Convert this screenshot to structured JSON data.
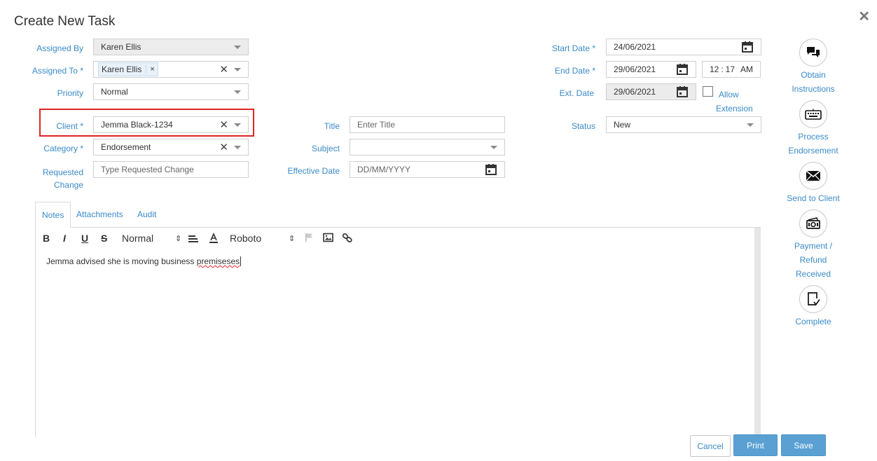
{
  "dialog": {
    "title": "Create New Task"
  },
  "form": {
    "assigned_by": {
      "label": "Assigned By",
      "value": "Karen Ellis"
    },
    "assigned_to": {
      "label": "Assigned To *",
      "tag": "Karen Ellis",
      "tag_remove": "×"
    },
    "priority": {
      "label": "Priority",
      "value": "Normal"
    },
    "client": {
      "label": "Client *",
      "value": "Jemma Black-1234"
    },
    "category": {
      "label": "Category *",
      "value": "Endorsement"
    },
    "requested_change": {
      "label_line1": "Requested",
      "label_line2": "Change",
      "placeholder": "Type Requested Change"
    },
    "title": {
      "label": "Title",
      "placeholder": "Enter Title"
    },
    "subject": {
      "label": "Subject",
      "value": ""
    },
    "effective_date": {
      "label": "Effective Date",
      "placeholder": "DD/MM/YYYY"
    },
    "start_date": {
      "label": "Start Date *",
      "value": "24/06/2021"
    },
    "end_date": {
      "label": "End Date *",
      "value": "29/06/2021",
      "time_hour": "12",
      "time_sep": ":",
      "time_min": "17",
      "time_ampm": "AM"
    },
    "ext_date": {
      "label": "Ext. Date",
      "value": "29/06/2021"
    },
    "allow_extension": {
      "line1": "Allow",
      "line2": "Extension",
      "checked": false
    },
    "status": {
      "label": "Status",
      "value": "New"
    }
  },
  "tabs": [
    {
      "label": "Notes",
      "active": true
    },
    {
      "label": "Attachments",
      "active": false
    },
    {
      "label": "Audit",
      "active": false
    }
  ],
  "editor": {
    "toolbar": {
      "bold": "B",
      "italic": "I",
      "underline": "U",
      "strike": "S",
      "size": "Normal",
      "font": "Roboto"
    },
    "content_before": "Jemma advised she is moving business ",
    "content_misspelled": "premiseses"
  },
  "actions": [
    {
      "label_lines": [
        "Obtain",
        "Instructions"
      ],
      "icon": "chat-icon"
    },
    {
      "label_lines": [
        "Process",
        "Endorsement"
      ],
      "icon": "keyboard-icon"
    },
    {
      "label_lines": [
        "Send to Client"
      ],
      "icon": "envelope-icon"
    },
    {
      "label_lines": [
        "Payment /",
        "Refund",
        "Received"
      ],
      "icon": "cash-icon"
    },
    {
      "label_lines": [
        "Complete"
      ],
      "icon": "document-check-icon"
    }
  ],
  "footer": {
    "cancel": "Cancel",
    "print": "Print",
    "save": "Save"
  },
  "colors": {
    "accent": "#3a8bc8",
    "button": "#5aa0d2",
    "highlight": "#e02424"
  }
}
